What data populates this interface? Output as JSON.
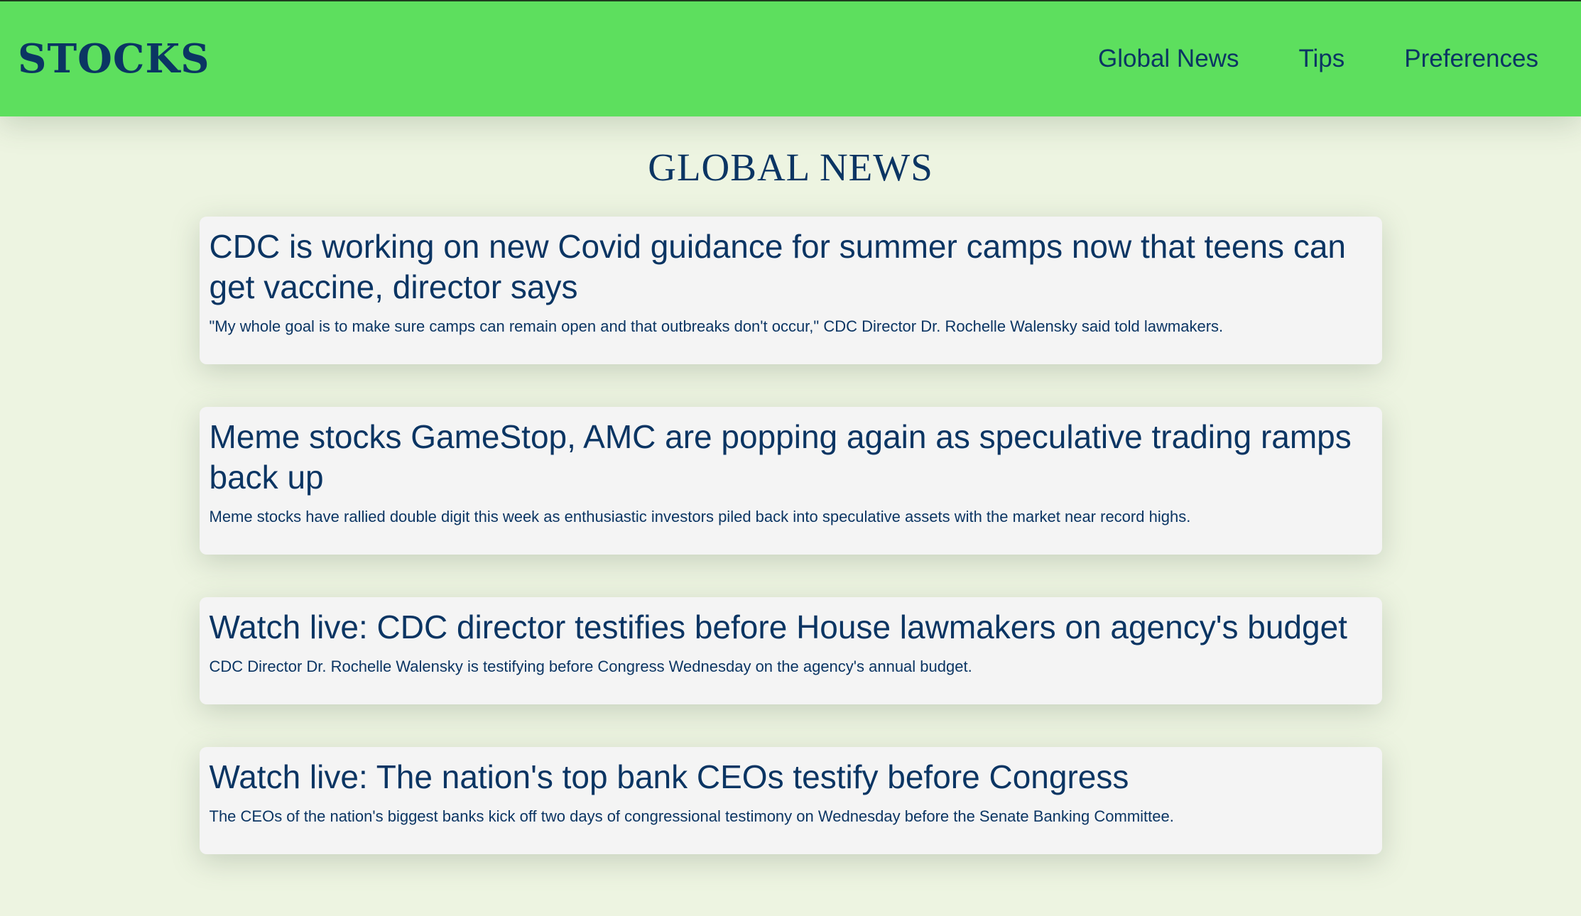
{
  "brand": {
    "name": "STOCKS"
  },
  "nav": {
    "items": [
      {
        "label": "Global News"
      },
      {
        "label": "Tips"
      },
      {
        "label": "Preferences"
      }
    ]
  },
  "main": {
    "title": "GLOBAL NEWS",
    "articles": [
      {
        "title": "CDC is working on new Covid guidance for summer camps now that teens can get vaccine, director says",
        "description": "\"My whole goal is to make sure camps can remain open and that outbreaks don't occur,\" CDC Director Dr. Rochelle Walensky said told lawmakers."
      },
      {
        "title": "Meme stocks GameStop, AMC are popping again as speculative trading ramps back up",
        "description": "Meme stocks have rallied double digit this week as enthusiastic investors piled back into speculative assets with the market near record highs."
      },
      {
        "title": "Watch live: CDC director testifies before House lawmakers on agency's budget",
        "description": "CDC Director Dr. Rochelle Walensky is testifying before Congress Wednesday on the agency's annual budget."
      },
      {
        "title": "Watch live: The nation's top bank CEOs testify before Congress",
        "description": "The CEOs of the nation's biggest banks kick off two days of congressional testimony on Wednesday before the Senate Banking Committee."
      }
    ]
  },
  "colors": {
    "navbar_bg": "#5ddf5e",
    "page_bg": "#edf4e1",
    "card_bg": "#f4f4f4",
    "text": "#0b3563"
  }
}
